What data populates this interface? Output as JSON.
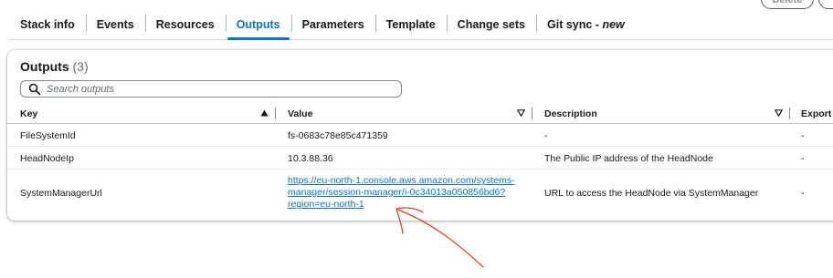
{
  "header_buttons": {
    "delete": "Delete"
  },
  "tabs": [
    {
      "label": "Stack info",
      "active": false
    },
    {
      "label": "Events",
      "active": false
    },
    {
      "label": "Resources",
      "active": false
    },
    {
      "label": "Outputs",
      "active": true
    },
    {
      "label": "Parameters",
      "active": false
    },
    {
      "label": "Template",
      "active": false
    },
    {
      "label": "Change sets",
      "active": false
    },
    {
      "label": "Git sync - ",
      "tag": "new",
      "active": false
    }
  ],
  "outputs": {
    "title": "Outputs",
    "count": "(3)",
    "search_placeholder": "Search outputs",
    "columns": {
      "key": "Key",
      "value": "Value",
      "description": "Description",
      "export": "Export n"
    },
    "rows": [
      {
        "key": "FileSystemId",
        "value": "fs-0683c78e85c471359",
        "description": "-",
        "export": "-"
      },
      {
        "key": "HeadNodeIp",
        "value": "10.3.88.36",
        "description": "The Public IP address of the HeadNode",
        "export": "-"
      },
      {
        "key": "SystemManagerUrl",
        "value_lines": [
          "https://eu-north-1.console.aws.amazon.com/systems-",
          "manager/session-manager/i-0c34013a050856bd6?",
          "region=eu-north-1"
        ],
        "description": "URL to access the HeadNode via SystemManager",
        "export": "-"
      }
    ]
  },
  "colors": {
    "accent": "#0972d3",
    "annotation": "#e8401c",
    "text": "#16191f"
  },
  "icons": {
    "search": "search-icon",
    "sort_asc": "sort-ascending-icon",
    "sort_desc": "sort-descending-icon"
  }
}
